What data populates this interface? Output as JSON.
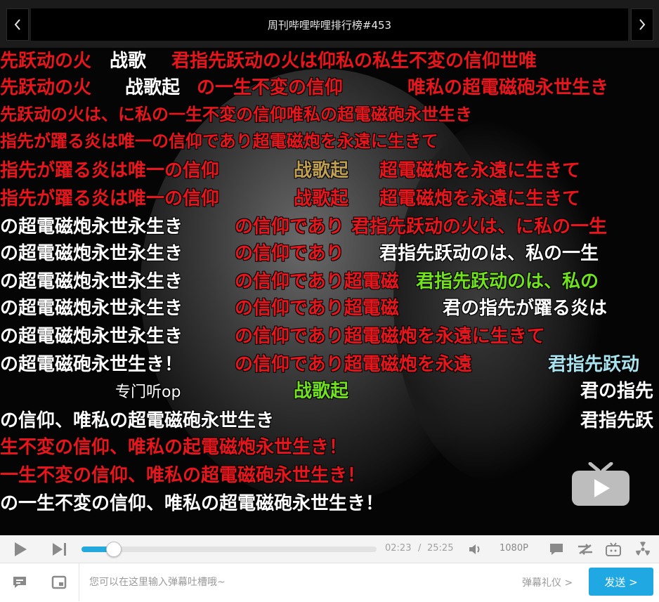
{
  "header": {
    "title": "周刊哔哩哔哩排行榜#453",
    "prev_icon": "chevron-left-icon",
    "next_icon": "chevron-right-icon"
  },
  "danmaku": [
    {
      "text": "先跃动の火",
      "color": "red"
    },
    {
      "text": "战歌",
      "color": "white"
    },
    {
      "text": "君指先跃动の火は仰私の私生不変の信仰世唯",
      "color": "red"
    },
    {
      "text": "先跃动の火",
      "color": "red"
    },
    {
      "text": "战歌起",
      "color": "white"
    },
    {
      "text": "の一生不変の信仰",
      "color": "red"
    },
    {
      "text": "唯私の超電磁砲永世生き",
      "color": "red"
    },
    {
      "text": "先跃动の火は、に私の一生不変の信仰唯私の超電磁砲永世生き",
      "color": "red"
    },
    {
      "text": "指先が躍る炎は唯一の信仰であり超電磁炮を永遠に生きて",
      "color": "red"
    },
    {
      "text": "指先が躍る炎は唯一の信仰",
      "color": "red"
    },
    {
      "text": "战歌起",
      "color": "gold"
    },
    {
      "text": "超電磁炮を永遠に生きて",
      "color": "red"
    },
    {
      "text": "指先が躍る炎は唯一の信仰",
      "color": "red"
    },
    {
      "text": "战歌起",
      "color": "red"
    },
    {
      "text": "超電磁炮を永遠に生きて",
      "color": "red"
    },
    {
      "text": "の超電磁炮永世永生き",
      "color": "white"
    },
    {
      "text": "の信仰であり",
      "color": "red"
    },
    {
      "text": "君指先跃动の火は、に私の一生",
      "color": "red"
    },
    {
      "text": "の超電磁炮永世永生き",
      "color": "white"
    },
    {
      "text": "の信仰であり",
      "color": "red"
    },
    {
      "text": "君指先跃动のは、私の一生",
      "color": "white"
    },
    {
      "text": "の超電磁炮永世永生き",
      "color": "white"
    },
    {
      "text": "の信仰であり超電磁",
      "color": "red"
    },
    {
      "text": "君指先跃动のは、私の",
      "color": "green"
    },
    {
      "text": "の超電磁炮永世永生き",
      "color": "white"
    },
    {
      "text": "の信仰であり超電磁",
      "color": "red"
    },
    {
      "text": "君の指先が躍る炎は",
      "color": "white"
    },
    {
      "text": "の超電磁炮永世永生き",
      "color": "white"
    },
    {
      "text": "の信仰であり超電磁炮を永遠に生きて",
      "color": "red"
    },
    {
      "text": "の超電磁砲永世生き！",
      "color": "white"
    },
    {
      "text": "の信仰であり超電磁炮を永遠",
      "color": "red"
    },
    {
      "text": "君指先跃动",
      "color": "cyan"
    },
    {
      "text": "专门听op",
      "color": "white"
    },
    {
      "text": "战歌起",
      "color": "green"
    },
    {
      "text": "君の指先",
      "color": "white"
    },
    {
      "text": "の信仰、唯私の超電磁砲永世生き",
      "color": "white"
    },
    {
      "text": "君指先跃",
      "color": "white"
    },
    {
      "text": "生不変の信仰、唯私の起電磁炮永世生き！",
      "color": "red"
    },
    {
      "text": "一生不変の信仰、唯私の超電磁砲永世生き！",
      "color": "red"
    },
    {
      "text": "の一生不変の信仰、唯私の超電磁砲永世生き！",
      "color": "white"
    }
  ],
  "controls": {
    "play_icon": "play-icon",
    "next_icon": "skip-next-icon",
    "progress_fraction": 0.11,
    "current_time": "02:23",
    "separator": "/",
    "duration": "25:25",
    "volume_icon": "volume-icon",
    "quality": "1080P",
    "danmaku_toggle_icon": "danmaku-bubble-icon",
    "loop_icon": "loop-icon",
    "tv_icon": "tv-icon",
    "radiation_icon": "radiation-icon"
  },
  "input": {
    "placeholder": "您可以在这里输入弹幕吐槽哦~",
    "etiquette": "弹幕礼仪 >",
    "send": "发送 >",
    "left_icon_1": "comment-icon",
    "left_icon_2": "picture-in-picture-icon"
  },
  "colors": {
    "accent": "#1fa8e1",
    "danmaku_red": "#e8161c",
    "danmaku_green": "#71e21b"
  }
}
